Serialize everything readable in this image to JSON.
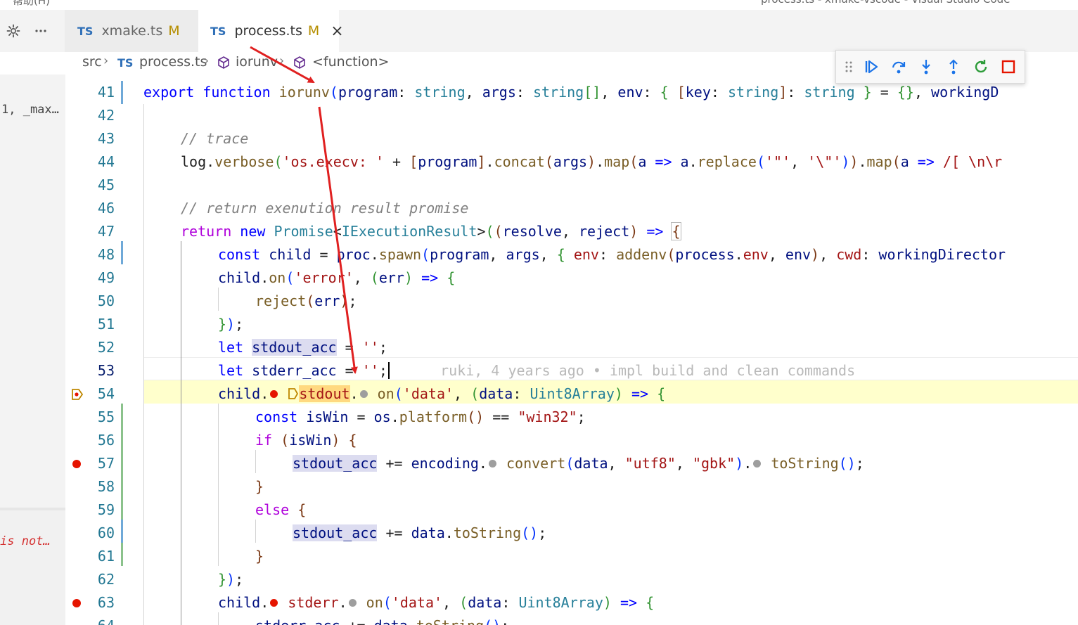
{
  "window": {
    "menu_fragment": "帮助(H)",
    "title": "process.ts - xmake-vscode - Visual Studio Code"
  },
  "activity": {
    "settings_icon": "gear-icon",
    "more_icon": "ellipsis-icon"
  },
  "tabs": [
    {
      "lang": "TS",
      "label": "xmake.ts",
      "status": "M",
      "active": false
    },
    {
      "lang": "TS",
      "label": "process.ts",
      "status": "M",
      "active": true,
      "close": "×"
    }
  ],
  "breadcrumb": {
    "folder": "src",
    "file_lang": "TS",
    "file": "process.ts",
    "symbol": "iorunv",
    "function": "<function>"
  },
  "left_panel": {
    "text1": "1, _max…",
    "text2": "is not…"
  },
  "colors": {
    "accent": "#0066bf",
    "breakpoint": "#e51400",
    "current_line": "#ffffcc",
    "annotation_arrow": "#e02020"
  },
  "debug_toolbar": [
    {
      "name": "drag-handle-icon"
    },
    {
      "name": "continue-icon"
    },
    {
      "name": "step-over-icon"
    },
    {
      "name": "step-into-icon"
    },
    {
      "name": "step-out-icon"
    },
    {
      "name": "restart-icon"
    },
    {
      "name": "stop-icon"
    }
  ],
  "editor": {
    "line_numbers": [
      "41",
      "42",
      "43",
      "44",
      "45",
      "46",
      "47",
      "48",
      "49",
      "50",
      "51",
      "52",
      "53",
      "54",
      "55",
      "56",
      "57",
      "58",
      "59",
      "60",
      "61",
      "62",
      "63",
      "64"
    ],
    "t41": {
      "kw1": "export",
      "kw2": "function",
      "name": "iorunv",
      "p1": "program",
      "t1": "string",
      "p2": "args",
      "t2": "string",
      "p3": "env",
      "key": "key",
      "t3": "string",
      "t4": "string",
      "p4": "workingD"
    },
    "t43": "// trace",
    "t44": {
      "obj": "log",
      "fn": "verbose",
      "str": "'os.execv: '",
      "prog": "program",
      "concat": "concat",
      "args": "args",
      "map": "map",
      "a": "a",
      "replace": "replace",
      "s1": "'\"'",
      "s2": "'\\\"'",
      "map2": "map",
      "a2": "a",
      "rest": "/[ \\n\\r"
    },
    "t46": "// return exenution result promise",
    "t47": {
      "kw": "return",
      "kw2": "new",
      "cls": "Promise",
      "iface": "IExecutionResult",
      "r1": "resolve",
      "r2": "reject"
    },
    "t48": {
      "kw": "const",
      "v": "child",
      "obj": "proc",
      "fn": "spawn",
      "a1": "program",
      "a2": "args",
      "k1": "env",
      "fn2": "addenv",
      "o2": "process",
      "p2": "env",
      "a3": "env",
      "k2": "cwd",
      "a4": "workingDirector"
    },
    "t49": {
      "obj": "child",
      "fn": "on",
      "str": "'error'",
      "p": "err"
    },
    "t50": {
      "fn": "reject",
      "p": "err"
    },
    "t52": {
      "kw": "let",
      "v": "stdout_acc",
      "str": "''"
    },
    "t53": {
      "kw": "let",
      "v": "stderr_acc",
      "str": "''",
      "blame": "ruki, 4 years ago • impl build and clean commands"
    },
    "t54": {
      "obj": "child",
      "v": "stdout",
      "fn": "on",
      "str": "'data'",
      "p": "data",
      "t": "Uint8Array"
    },
    "t55": {
      "kw": "const",
      "v": "isWin",
      "obj": "os",
      "fn": "platform",
      "str": "\"win32\""
    },
    "t56": {
      "kw": "if",
      "v": "isWin"
    },
    "t57": {
      "v": "stdout_acc",
      "obj": "encoding",
      "fn": "convert",
      "a1": "data",
      "s1": "\"utf8\"",
      "s2": "\"gbk\"",
      "fn2": "toString"
    },
    "t59": "else",
    "t60": {
      "v": "stdout_acc",
      "obj": "data",
      "fn": "toString"
    },
    "t63": {
      "obj": "child",
      "v": "stderr",
      "fn": "on",
      "str": "'data'",
      "p": "data",
      "t": "Uint8Array"
    },
    "t64": {
      "v": "stderr_acc",
      "obj": "data",
      "fn": "toString"
    }
  }
}
